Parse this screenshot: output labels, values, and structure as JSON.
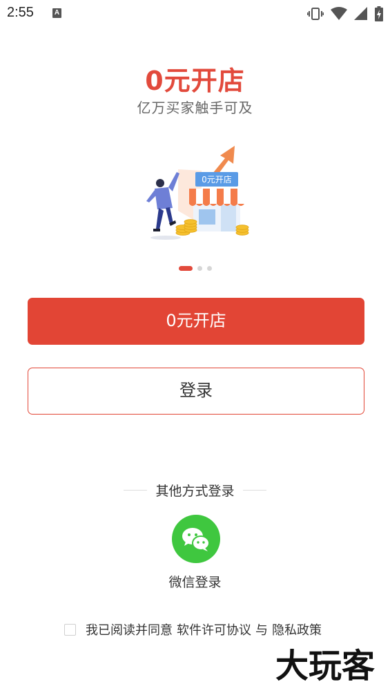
{
  "status_bar": {
    "time": "2:55",
    "notification_icon": "A",
    "icons": [
      "vibrate-icon",
      "wifi-icon",
      "signal-icon",
      "battery-charging-icon"
    ]
  },
  "hero": {
    "title": "0元开店",
    "subtitle": "亿万买家触手可及",
    "illustration_sign": "0元开店",
    "illustration_icon": "store-growth-illustration"
  },
  "carousel": {
    "total": 3,
    "active_index": 0
  },
  "buttons": {
    "open_store": "0元开店",
    "login": "登录"
  },
  "other_login": {
    "label": "其他方式登录",
    "wechat_label": "微信登录",
    "wechat_icon": "wechat-icon"
  },
  "agreement": {
    "prefix": "我已阅读并同意",
    "license_link": "软件许可协议",
    "connector": "与",
    "privacy_link": "隐私政策",
    "checked": false
  },
  "watermark": {
    "text": "大玩客"
  },
  "colors": {
    "accent": "#e24535",
    "title_red": "#e24a3c",
    "wechat_green": "#3fc73f",
    "subtitle_gray": "#666666"
  }
}
